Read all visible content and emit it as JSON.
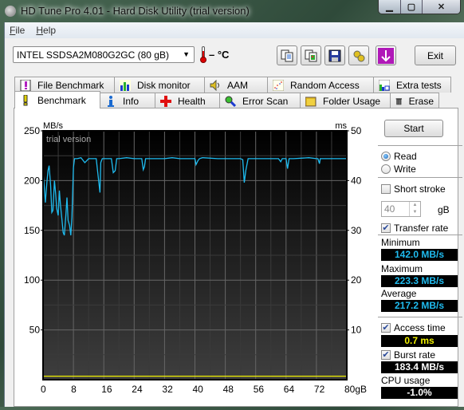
{
  "window": {
    "title": "HD Tune Pro 4.01 - Hard Disk Utility (trial version)",
    "controls": {
      "minimize": "minimize-icon",
      "maximize": "maximize-icon",
      "close": "close-icon"
    }
  },
  "menu": [
    {
      "label_accel": "F",
      "label_rest": "ile"
    },
    {
      "label_accel": "H",
      "label_rest": "elp"
    }
  ],
  "toolbar": {
    "drive": "INTEL SSDSA2M080G2GC (80 gB)",
    "temperature": "– °C",
    "buttons": [
      "copy-text-icon",
      "copy-screenshot-icon",
      "save-icon",
      "options-icon",
      "download-icon"
    ],
    "exit_label": "Exit"
  },
  "tabs_top": [
    {
      "label": "File Benchmark",
      "icon": "file-benchmark-icon"
    },
    {
      "label": "Disk monitor",
      "icon": "disk-monitor-icon"
    },
    {
      "label": "AAM",
      "icon": "speaker-icon"
    },
    {
      "label": "Random Access",
      "icon": "random-access-icon"
    },
    {
      "label": "Extra tests",
      "icon": "extra-tests-icon"
    }
  ],
  "tabs_bottom": [
    {
      "label": "Benchmark",
      "icon": "benchmark-icon",
      "active": true
    },
    {
      "label": "Info",
      "icon": "info-icon"
    },
    {
      "label": "Health",
      "icon": "health-icon"
    },
    {
      "label": "Error Scan",
      "icon": "error-scan-icon"
    },
    {
      "label": "Folder Usage",
      "icon": "folder-icon"
    },
    {
      "label": "Erase",
      "icon": "trash-icon"
    }
  ],
  "side": {
    "start_label": "Start",
    "read_label": "Read",
    "write_label": "Write",
    "mode": "Read",
    "short_stroke_label": "Short stroke",
    "short_stroke_checked": false,
    "short_stroke_value": "40",
    "short_stroke_unit": "gB",
    "transfer_rate_label": "Transfer rate",
    "transfer_rate_checked": true,
    "minimum_label": "Minimum",
    "minimum_value": "142.0 MB/s",
    "maximum_label": "Maximum",
    "maximum_value": "223.3 MB/s",
    "average_label": "Average",
    "average_value": "217.2 MB/s",
    "access_time_label": "Access time",
    "access_time_checked": true,
    "access_time_value": "0.7 ms",
    "burst_rate_label": "Burst rate",
    "burst_rate_checked": true,
    "burst_rate_value": "183.4 MB/s",
    "cpu_label": "CPU usage",
    "cpu_value": "-1.0%",
    "colors": {
      "transfer": "#1fbcf0",
      "access": "#f0f000",
      "cpu": "#ffffff"
    }
  },
  "chart_data": {
    "type": "line",
    "watermark": "trial version",
    "y_left_label": "MB/s",
    "y_right_label": "ms",
    "x_unit": "gB",
    "ylim_left": [
      0,
      250
    ],
    "ylim_right": [
      0,
      50
    ],
    "xlim": [
      0,
      80
    ],
    "y_left_ticks": [
      50,
      100,
      150,
      200,
      250
    ],
    "y_right_ticks": [
      10,
      20,
      30,
      40,
      50
    ],
    "x_ticks": [
      "0",
      "8",
      "16",
      "24",
      "32",
      "40",
      "48",
      "56",
      "64",
      "72",
      "80gB"
    ],
    "grid": true,
    "series": [
      {
        "name": "Transfer rate",
        "color": "#1fbcf0",
        "x": [
          0,
          0.3,
          0.6,
          1,
          1.3,
          1.6,
          2,
          2.3,
          2.6,
          3,
          3.3,
          3.6,
          4,
          4.3,
          4.6,
          5,
          5.3,
          5.6,
          6,
          6.3,
          6.6,
          7,
          7.3,
          7.6,
          8,
          8.3,
          8.6,
          9,
          10,
          11,
          12,
          12.4,
          12.8,
          14,
          15,
          15.2,
          15.6,
          16,
          18,
          18.5,
          19,
          19.4,
          20,
          22,
          24,
          26,
          26.4,
          26.7,
          27,
          28,
          30,
          32,
          34,
          36,
          38,
          40,
          40.3,
          40.8,
          41.2,
          42,
          46,
          50,
          52,
          52.6,
          53,
          53.4,
          54,
          56,
          60,
          62,
          62.6,
          63,
          64,
          64.4,
          64.8,
          65,
          66,
          70,
          72,
          72.4,
          72.8,
          73,
          74,
          76,
          78,
          80
        ],
        "values": [
          208,
          195,
          178,
          198,
          210,
          215,
          195,
          168,
          170,
          200,
          188,
          172,
          165,
          190,
          175,
          160,
          148,
          145,
          165,
          183,
          160,
          155,
          145,
          163,
          213,
          222,
          222,
          222,
          223,
          218,
          222,
          222,
          222,
          222,
          188,
          218,
          222,
          222,
          222,
          208,
          210,
          222,
          222,
          223,
          222,
          222,
          211,
          214,
          222,
          222,
          222,
          222,
          223,
          222,
          222,
          222,
          216,
          220,
          222,
          223,
          222,
          222,
          222,
          221,
          198,
          210,
          222,
          222,
          222,
          222,
          219,
          222,
          222,
          212,
          222,
          222,
          222,
          223,
          222,
          222,
          217,
          222,
          222,
          222,
          222,
          222
        ]
      },
      {
        "name": "Access time",
        "color": "#f0f000",
        "axis": "right",
        "value_ms": 0.7
      }
    ]
  }
}
